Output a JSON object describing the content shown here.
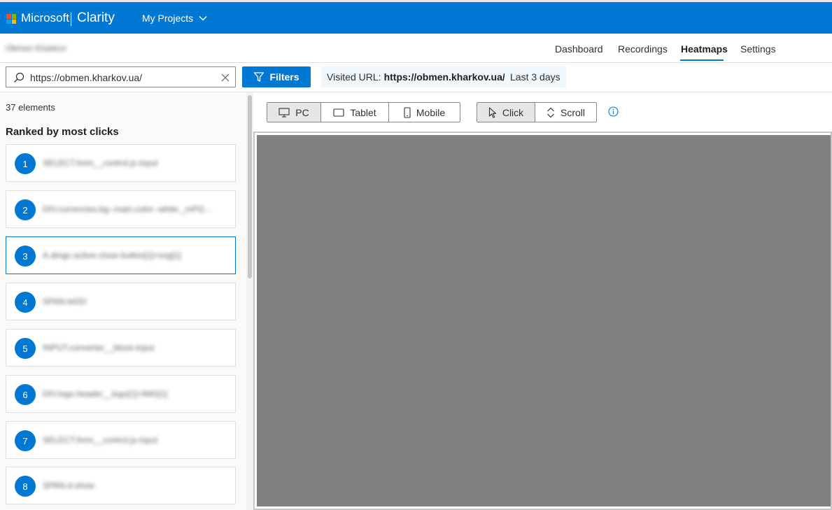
{
  "topbar": {
    "brand_ms": "Microsoft",
    "brand_product": "Clarity",
    "projects_label": "My Projects",
    "colors": {
      "bar": "#0078d4",
      "logo": [
        "#f25022",
        "#7fba00",
        "#00a4ef",
        "#ffb900"
      ]
    }
  },
  "subheader": {
    "project_name": "Obmen Kharkov",
    "nav": [
      {
        "label": "Dashboard"
      },
      {
        "label": "Recordings"
      },
      {
        "label": "Heatmaps"
      },
      {
        "label": "Settings"
      }
    ],
    "active_nav": "Heatmaps"
  },
  "filters": {
    "search_value": "https://obmen.kharkov.ua/",
    "filters_label": "Filters",
    "url_chip_label": "Visited URL:",
    "url_chip_value": "https://obmen.kharkov.ua/",
    "date_chip": "Last 3 days"
  },
  "left_panel": {
    "element_count": "37 elements",
    "ranked_title": "Ranked by most clicks",
    "items": [
      {
        "rank": "1",
        "label": "SELECT.form__control.js-input"
      },
      {
        "rank": "2",
        "label": "DIV.currencies.bg--main.color--white._mPi2..."
      },
      {
        "rank": "3",
        "label": "A.dmgc-active-close-button[1]>svg[1]"
      },
      {
        "rank": "4",
        "label": "SPAN.teDD"
      },
      {
        "rank": "5",
        "label": "INPUT.converter__block-input"
      },
      {
        "rank": "6",
        "label": "DIV.logo.header__logo[1]>IMG[1]"
      },
      {
        "rank": "7",
        "label": "SELECT.form__control.js-input"
      },
      {
        "rank": "8",
        "label": "SPAN.d-show"
      }
    ],
    "selected_rank": "3"
  },
  "toolbar": {
    "devices": [
      {
        "label": "PC",
        "icon": "monitor-icon",
        "active": true
      },
      {
        "label": "Tablet",
        "icon": "tablet-icon",
        "active": false
      },
      {
        "label": "Mobile",
        "icon": "mobile-icon",
        "active": false
      }
    ],
    "modes": [
      {
        "label": "Click",
        "icon": "cursor-icon",
        "active": true
      },
      {
        "label": "Scroll",
        "icon": "scroll-icon",
        "active": false
      }
    ]
  }
}
